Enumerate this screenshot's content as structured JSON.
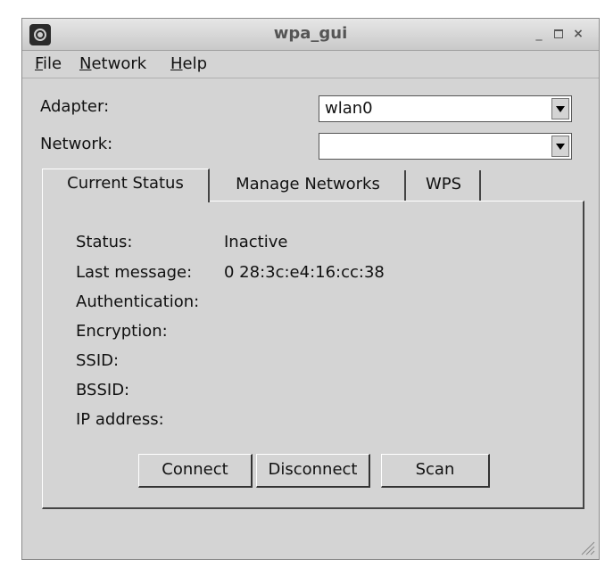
{
  "window": {
    "title": "wpa_gui"
  },
  "titlebar": {
    "minimize_glyph": "_",
    "close_glyph": "×"
  },
  "menu": {
    "file": {
      "accel": "F",
      "rest": "ile"
    },
    "network": {
      "accel": "N",
      "rest": "etwork"
    },
    "help": {
      "accel": "H",
      "rest": "elp"
    }
  },
  "adapter": {
    "label": "Adapter:",
    "value": "wlan0"
  },
  "network": {
    "label": "Network:",
    "value": ""
  },
  "tabs": [
    {
      "label": "Current Status",
      "active": true
    },
    {
      "label": "Manage Networks",
      "active": false
    },
    {
      "label": "WPS",
      "active": false
    }
  ],
  "status": {
    "status_label": "Status:",
    "status_value": "Inactive",
    "last_message_label": "Last message:",
    "last_message_value": "0 28:3c:e4:16:cc:38",
    "authentication_label": "Authentication:",
    "encryption_label": "Encryption:",
    "ssid_label": "SSID:",
    "bssid_label": "BSSID:",
    "ip_label": "IP address:"
  },
  "buttons": {
    "connect": "Connect",
    "disconnect": "Disconnect",
    "scan": "Scan"
  },
  "icons": {
    "app": "wifi-app-icon",
    "dropdown": "chevron-down-icon",
    "resize": "resize-grip-icon"
  }
}
